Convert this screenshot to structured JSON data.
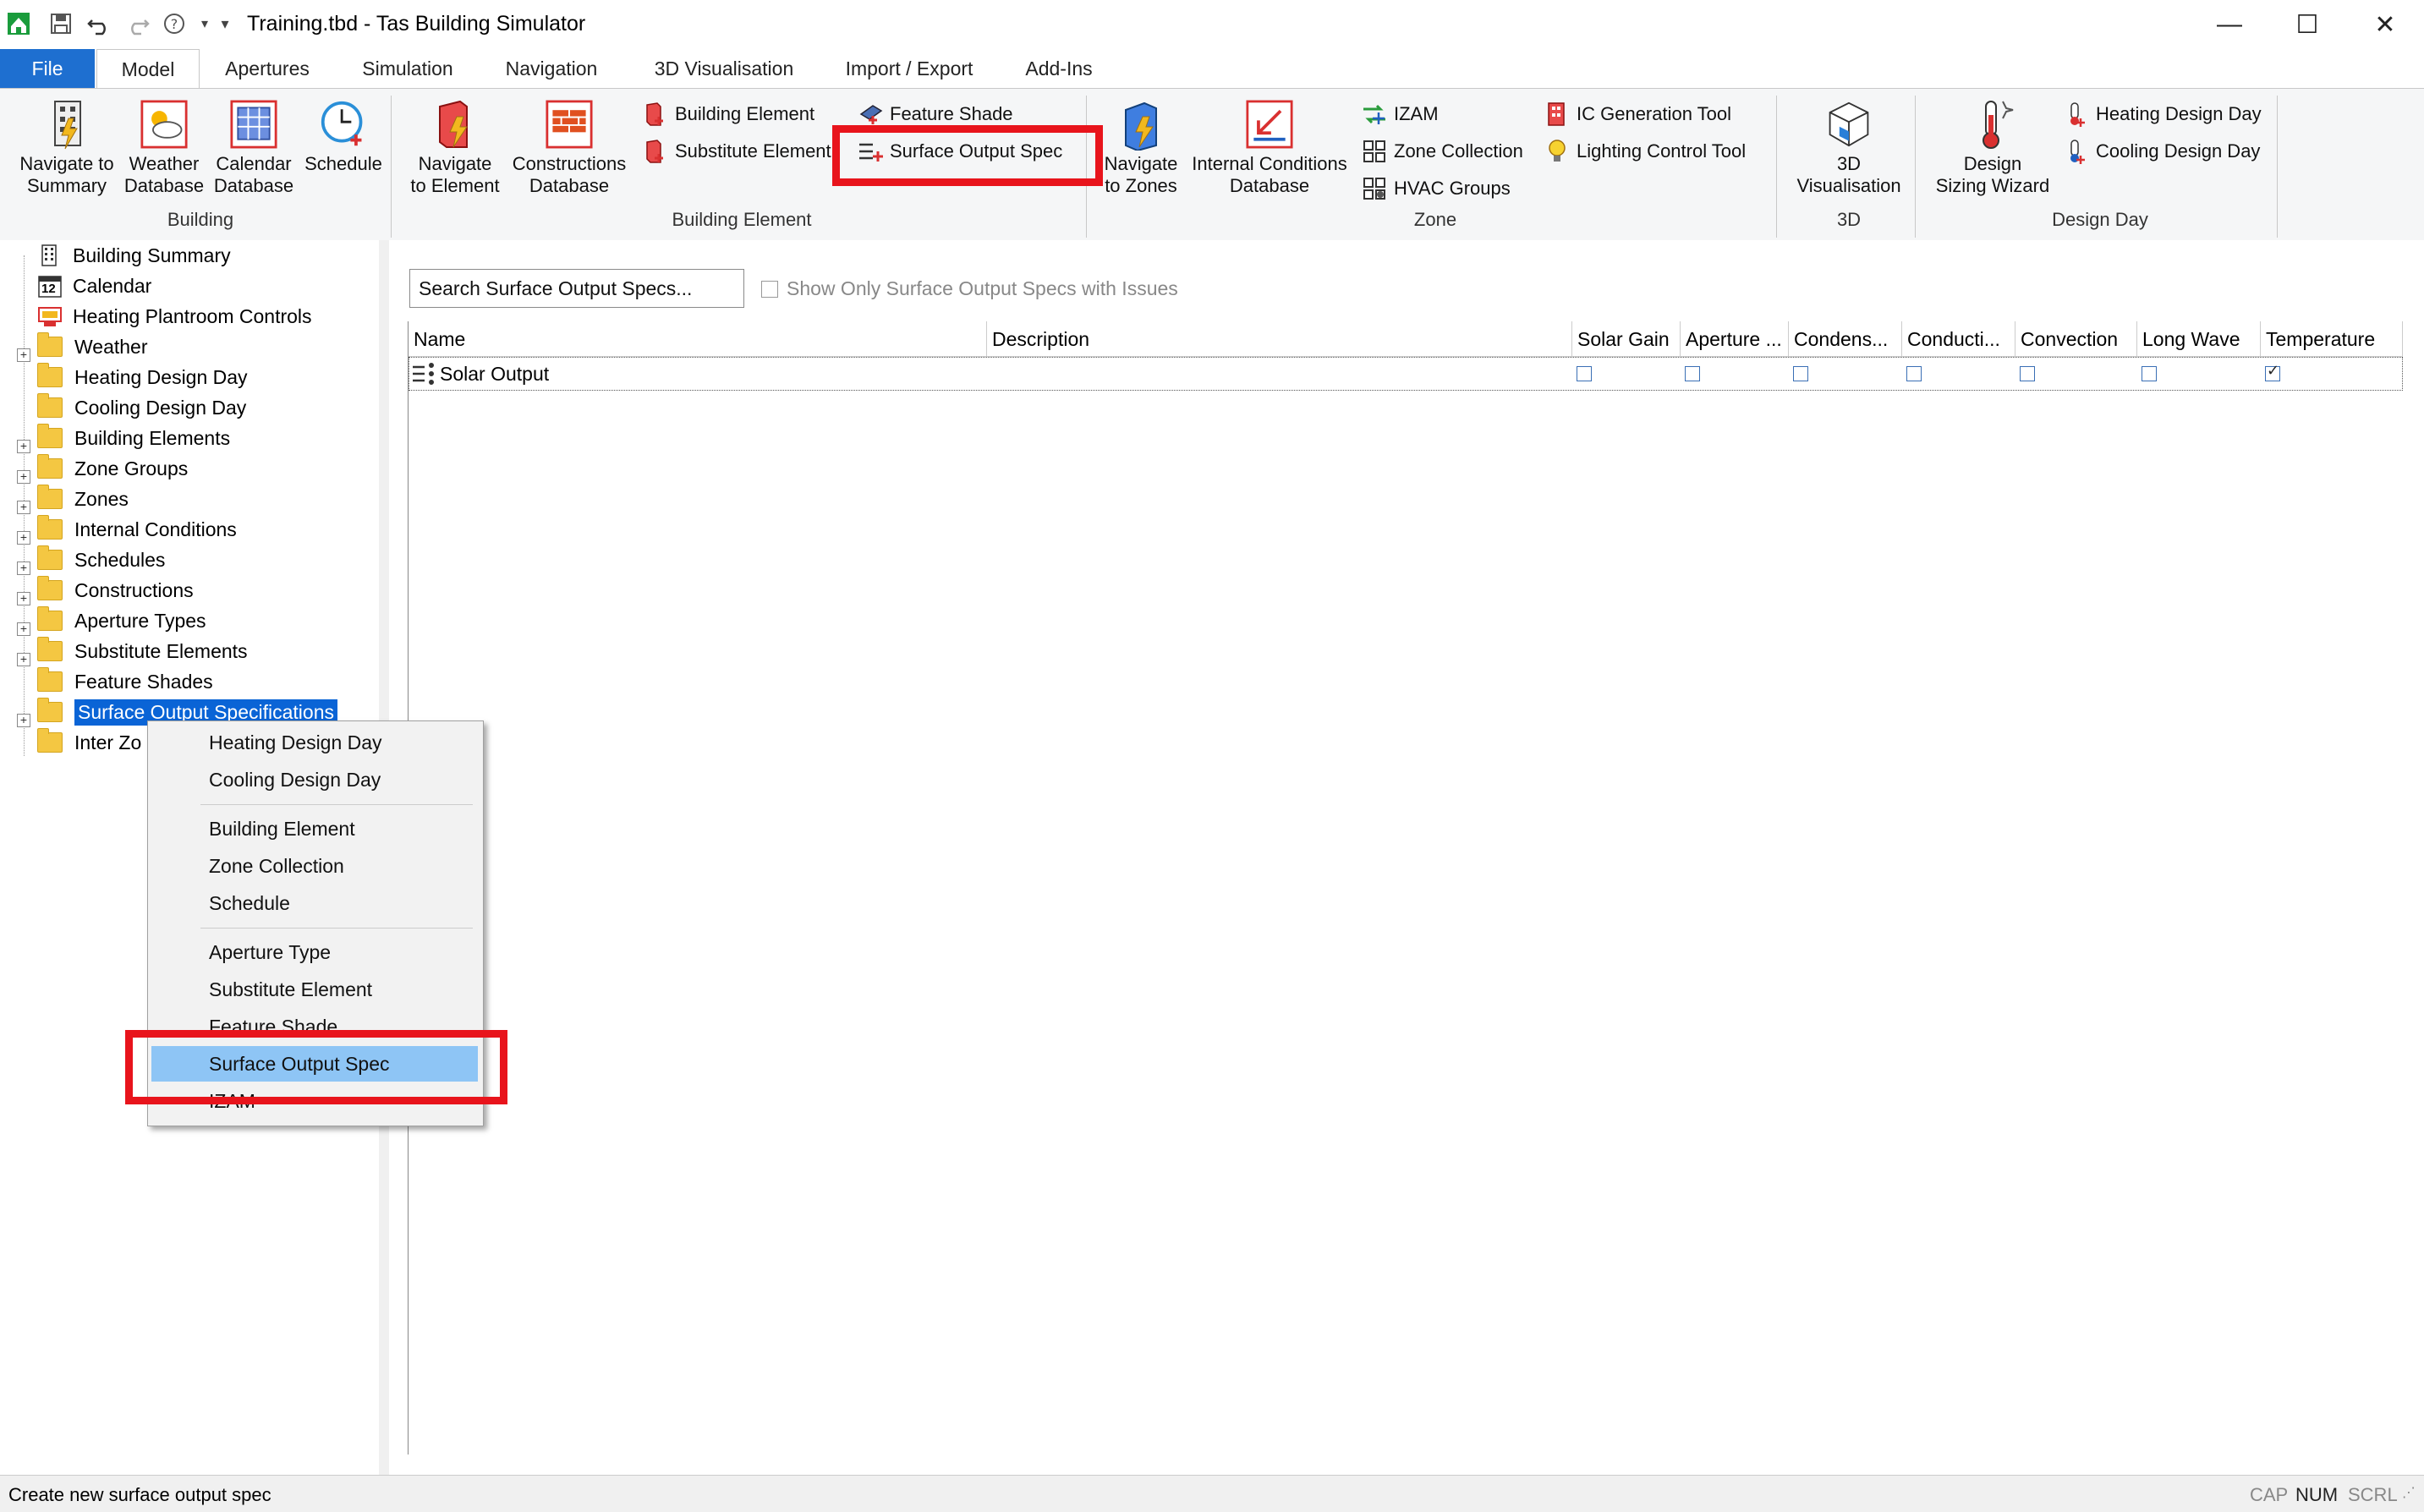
{
  "window": {
    "title": "Training.tbd - Tas Building Simulator",
    "controls": {
      "minimize": "—",
      "maximize": "☐",
      "close": "✕"
    }
  },
  "ribbon_tabs": [
    "File",
    "Model",
    "Apertures",
    "Simulation",
    "Navigation",
    "3D Visualisation",
    "Import / Export",
    "Add-Ins"
  ],
  "ribbon": {
    "building": {
      "label": "Building",
      "navigate_summary": [
        "Navigate to",
        "Summary"
      ],
      "weather_db": [
        "Weather",
        "Database"
      ],
      "calendar_db": [
        "Calendar",
        "Database"
      ],
      "schedule": "Schedule"
    },
    "building_element": {
      "label": "Building Element",
      "navigate_element": [
        "Navigate",
        "to Element"
      ],
      "constructions_db": [
        "Constructions",
        "Database"
      ],
      "building_element": "Building Element",
      "substitute_element": "Substitute Element",
      "feature_shade": "Feature Shade",
      "surface_output_spec": "Surface Output Spec"
    },
    "zone": {
      "label": "Zone",
      "navigate_zones": [
        "Navigate",
        "to Zones"
      ],
      "internal_conditions_db": [
        "Internal Conditions",
        "Database"
      ],
      "izam": "IZAM",
      "zone_collection": "Zone Collection",
      "hvac_groups": "HVAC Groups",
      "ic_generation_tool": "IC Generation Tool",
      "lighting_control_tool": "Lighting Control Tool"
    },
    "threed": {
      "label": "3D",
      "visualisation": [
        "3D",
        "Visualisation"
      ]
    },
    "design_day": {
      "label": "Design Day",
      "sizing_wizard": [
        "Design",
        "Sizing Wizard"
      ],
      "heating_design_day": "Heating Design Day",
      "cooling_design_day": "Cooling Design Day"
    }
  },
  "tree": {
    "items": [
      "Building Summary",
      "Calendar",
      "Heating Plantroom Controls",
      "Weather",
      "Heating Design Day",
      "Cooling Design Day",
      "Building Elements",
      "Zone Groups",
      "Zones",
      "Internal Conditions",
      "Schedules",
      "Constructions",
      "Aperture Types",
      "Substitute Elements",
      "Feature Shades",
      "Surface Output Specifications",
      "Inter Zo"
    ],
    "calendar_icon_number": "12"
  },
  "main": {
    "search_value": "Search Surface Output Specs...",
    "filter_label": "Show Only Surface Output Specs with Issues",
    "columns": [
      "Name",
      "Description",
      "Solar Gain",
      "Aperture ...",
      "Condens...",
      "Conducti...",
      "Convection",
      "Long Wave",
      "Temperature"
    ],
    "rows": [
      {
        "name": "Solar Output",
        "description": "",
        "flags": [
          false,
          false,
          false,
          false,
          false,
          false,
          true
        ]
      }
    ]
  },
  "context_menu": {
    "items": [
      "Heating Design Day",
      "Cooling Design Day",
      "Building Element",
      "Zone Collection",
      "Schedule",
      "Aperture Type",
      "Substitute Element",
      "Feature Shade",
      "Surface Output Spec",
      "IZAM"
    ]
  },
  "status": {
    "text": "Create new surface output spec",
    "indicators": [
      "CAP",
      "NUM",
      "SCRL"
    ]
  },
  "colors": {
    "file_tab": "#1e6fd0",
    "highlight": "#8ec5f5",
    "selection": "#0a64d6",
    "annotation": "#e8141c",
    "folder": "#f4c742"
  }
}
